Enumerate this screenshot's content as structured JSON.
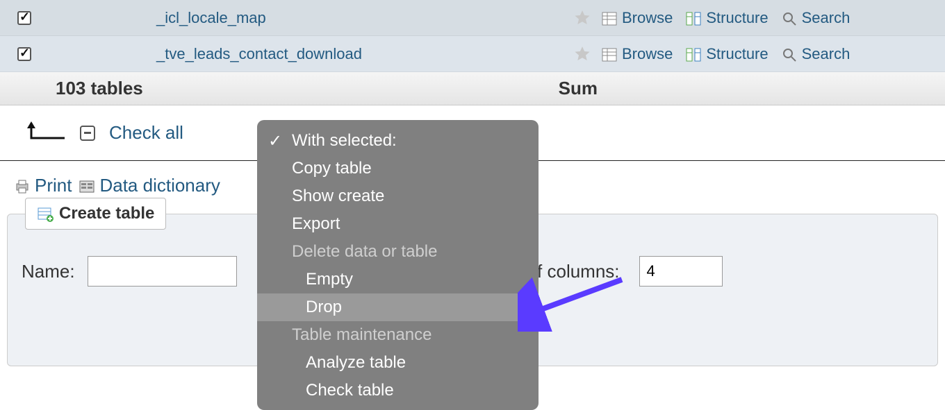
{
  "rows": [
    {
      "name": "_icl_locale_map"
    },
    {
      "name": "_tve_leads_contact_download"
    }
  ],
  "row_actions": {
    "browse": "Browse",
    "structure": "Structure",
    "search": "Search"
  },
  "summary": {
    "left": "103 tables",
    "right": "Sum"
  },
  "checkall": {
    "label": "Check all"
  },
  "links": {
    "print": "Print",
    "dict": "Data dictionary"
  },
  "create": {
    "button": "Create table",
    "name_label": "Name:",
    "name_value": "",
    "cols_label": "of columns:",
    "cols_value": "4"
  },
  "dropdown": {
    "header": "With selected:",
    "copy": "Copy table",
    "showcreate": "Show create",
    "export": "Export",
    "grp_delete": "Delete data or table",
    "empty": "Empty",
    "drop": "Drop",
    "grp_maint": "Table maintenance",
    "analyze": "Analyze table",
    "check": "Check table"
  }
}
